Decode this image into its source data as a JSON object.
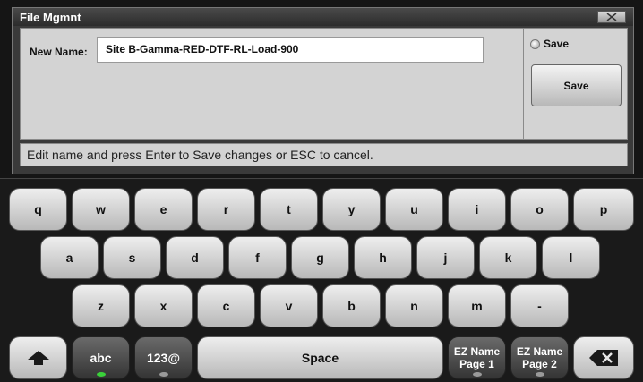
{
  "dialog": {
    "title": "File Mgmnt",
    "name_label": "New Name:",
    "name_value": "Site B-Gamma-RED-DTF-RL-Load-900",
    "save_option_label": "Save",
    "save_button_label": "Save",
    "status_text": "Edit name and press Enter to Save changes or ESC to cancel."
  },
  "keyboard": {
    "row1": [
      "q",
      "w",
      "e",
      "r",
      "t",
      "y",
      "u",
      "i",
      "o",
      "p"
    ],
    "row2": [
      "a",
      "s",
      "d",
      "f",
      "g",
      "h",
      "j",
      "k",
      "l"
    ],
    "row3": [
      "z",
      "x",
      "c",
      "v",
      "b",
      "n",
      "m",
      "-"
    ],
    "abc_label": "abc",
    "num_label": "123@",
    "space_label": "Space",
    "ez1_line1": "EZ Name",
    "ez1_line2": "Page 1",
    "ez2_line1": "EZ Name",
    "ez2_line2": "Page 2",
    "icons": {
      "shift": "shift-up-arrow-icon",
      "backspace": "backspace-icon",
      "close": "close-x-icon"
    },
    "abc_active": true
  }
}
